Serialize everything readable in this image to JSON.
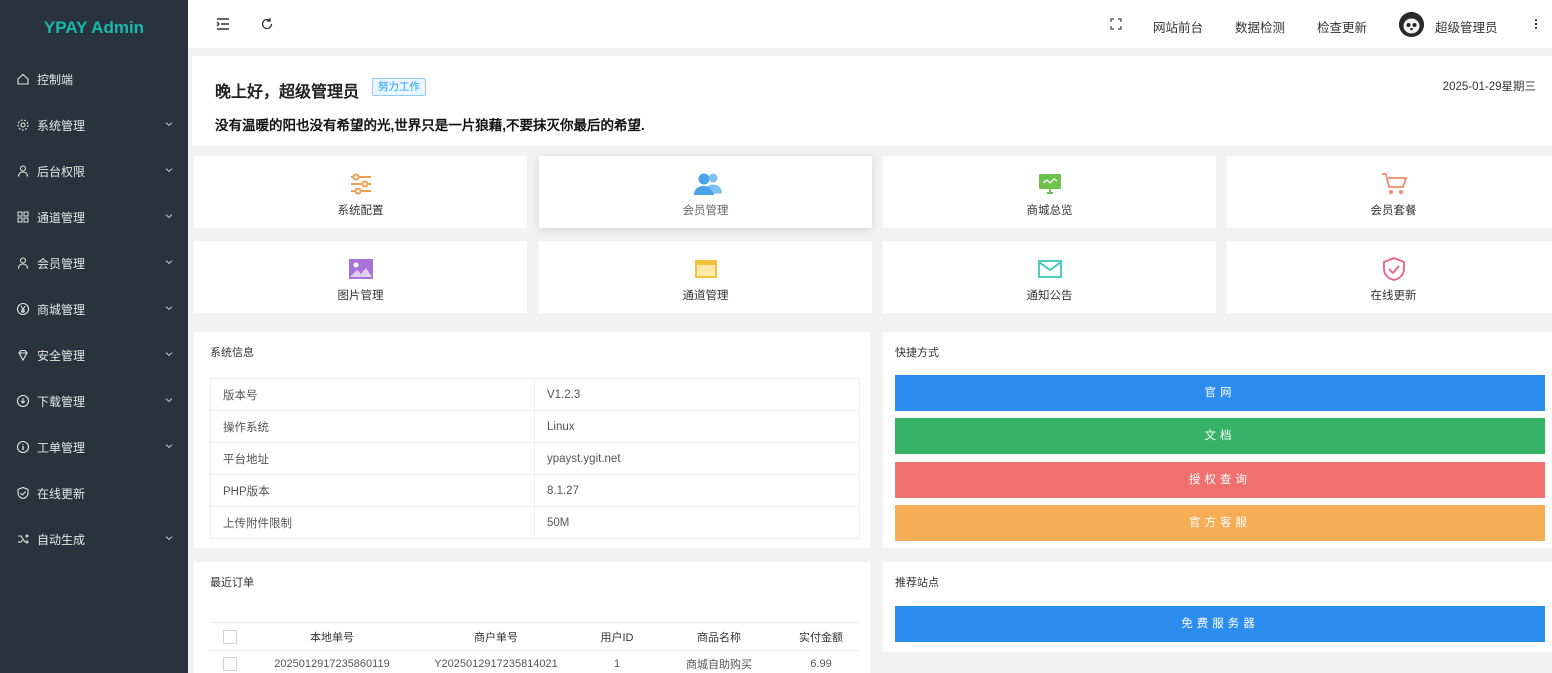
{
  "app": {
    "title": "YPAY Admin"
  },
  "sidebar": {
    "items": [
      {
        "label": "控制端",
        "icon": "home-icon",
        "has_children": false
      },
      {
        "label": "系统管理",
        "icon": "gear-icon",
        "has_children": true
      },
      {
        "label": "后台权限",
        "icon": "user-icon",
        "has_children": true
      },
      {
        "label": "通道管理",
        "icon": "apps-icon",
        "has_children": true
      },
      {
        "label": "会员管理",
        "icon": "user-icon",
        "has_children": true
      },
      {
        "label": "商城管理",
        "icon": "yen-icon",
        "has_children": true
      },
      {
        "label": "安全管理",
        "icon": "diamond-icon",
        "has_children": true
      },
      {
        "label": "下载管理",
        "icon": "download-icon",
        "has_children": true
      },
      {
        "label": "工单管理",
        "icon": "info-icon",
        "has_children": true
      },
      {
        "label": "在线更新",
        "icon": "shield-check-icon",
        "has_children": false
      },
      {
        "label": "自动生成",
        "icon": "shuffle-icon",
        "has_children": true
      }
    ]
  },
  "header": {
    "links": [
      "网站前台",
      "数据检测",
      "检查更新"
    ],
    "user_name": "超级管理员"
  },
  "greeting": {
    "title": "晚上好，超级管理员",
    "badge": "努力工作",
    "date": "2025-01-29星期三",
    "quote": "没有温暖的阳也没有希望的光,世界只是一片狼藉,不要抹灭你最后的希望."
  },
  "shortcuts": [
    {
      "label": "系统配置",
      "icon": "sliders-icon",
      "color": "#f0a050"
    },
    {
      "label": "会员管理",
      "icon": "users-icon",
      "color": "#4aa3e8"
    },
    {
      "label": "商城总览",
      "icon": "monitor-icon",
      "color": "#6cc24a"
    },
    {
      "label": "会员套餐",
      "icon": "cart-icon",
      "color": "#f08a6a"
    },
    {
      "label": "图片管理",
      "icon": "image-icon",
      "color": "#a872d8"
    },
    {
      "label": "通道管理",
      "icon": "window-icon",
      "color": "#f2c33a"
    },
    {
      "label": "通知公告",
      "icon": "mail-icon",
      "color": "#3cc8b4"
    },
    {
      "label": "在线更新",
      "icon": "shield-icon",
      "color": "#e8608a"
    }
  ],
  "system_info": {
    "title": "系统信息",
    "rows": [
      {
        "key": "版本号",
        "value": "V1.2.3"
      },
      {
        "key": "操作系统",
        "value": "Linux"
      },
      {
        "key": "平台地址",
        "value": "ypayst.ygit.net"
      },
      {
        "key": "PHP版本",
        "value": "8.1.27"
      },
      {
        "key": "上传附件限制",
        "value": "50M"
      }
    ]
  },
  "quick": {
    "title": "快捷方式",
    "buttons": [
      {
        "label": "官网",
        "color": "#2d8cf0"
      },
      {
        "label": "文档",
        "color": "#36b368"
      },
      {
        "label": "授权查询",
        "color": "#f07070"
      },
      {
        "label": "官方客服",
        "color": "#f6ad55"
      }
    ]
  },
  "orders": {
    "title": "最近订单",
    "columns": [
      "本地单号",
      "商户单号",
      "用户ID",
      "商品名称",
      "实付金额"
    ],
    "rows": [
      [
        "2025012917235860119",
        "Y2025012917235814021",
        "1",
        "商城自助购买",
        "6.99"
      ]
    ]
  },
  "recommend": {
    "title": "推荐站点",
    "buttons": [
      {
        "label": "免费服务器",
        "color": "#2d8cf0"
      }
    ]
  },
  "colors": {
    "sidebar_bg": "#28333e",
    "logo": "#16baaa",
    "accent": "#1e9fff"
  }
}
